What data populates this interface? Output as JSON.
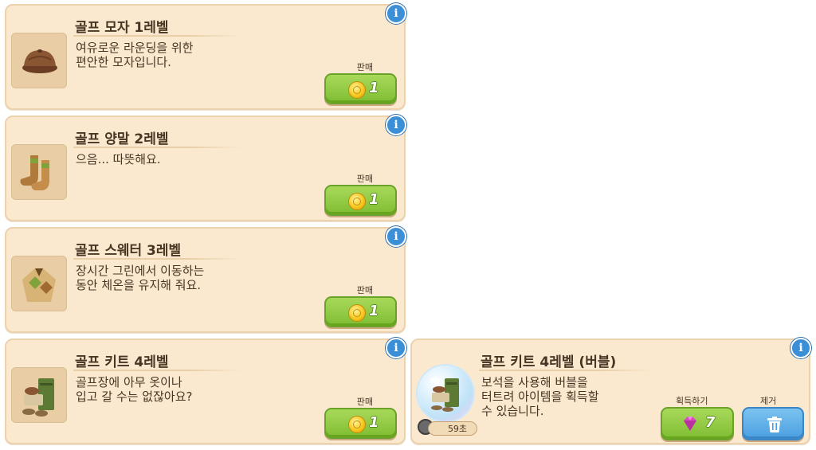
{
  "items": [
    {
      "title": "골프 모자 1레벨",
      "desc_line1": "여유로운 라운딩을 위한",
      "desc_line2": "편안한 모자입니다.",
      "sell_label": "판매",
      "price": "1",
      "icon": "golf-hat-icon"
    },
    {
      "title": "골프 양말 2레벨",
      "desc_line1": "으음... 따뜻해요.",
      "desc_line2": "",
      "sell_label": "판매",
      "price": "1",
      "icon": "golf-socks-icon"
    },
    {
      "title": "골프 스웨터 3레벨",
      "desc_line1": "장시간 그린에서 이동하는",
      "desc_line2": "동안 체온을 유지해 줘요.",
      "sell_label": "판매",
      "price": "1",
      "icon": "golf-sweater-icon"
    },
    {
      "title": "골프 키트 4레벨",
      "desc_line1": "골프장에 아무 옷이나",
      "desc_line2": "입고 갈 수는 없잖아요?",
      "sell_label": "판매",
      "price": "1",
      "icon": "golf-kit-icon"
    }
  ],
  "bubble_item": {
    "title": "골프 키트 4레벨 (버블)",
    "desc_line1": "보석을 사용해 버블을",
    "desc_line2": "터트려 아이템을 획득할",
    "desc_line3": "수 있습니다.",
    "timer": "59초",
    "get_label": "획득하기",
    "gem_cost": "7",
    "remove_label": "제거",
    "icon": "golf-kit-bubble-icon"
  },
  "colors": {
    "card_bg": "#fbe9cf",
    "sell_green": "#8cc63f",
    "remove_blue": "#4a9ee0",
    "gem_pink": "#d84ac0",
    "coin_gold": "#f5c518"
  }
}
